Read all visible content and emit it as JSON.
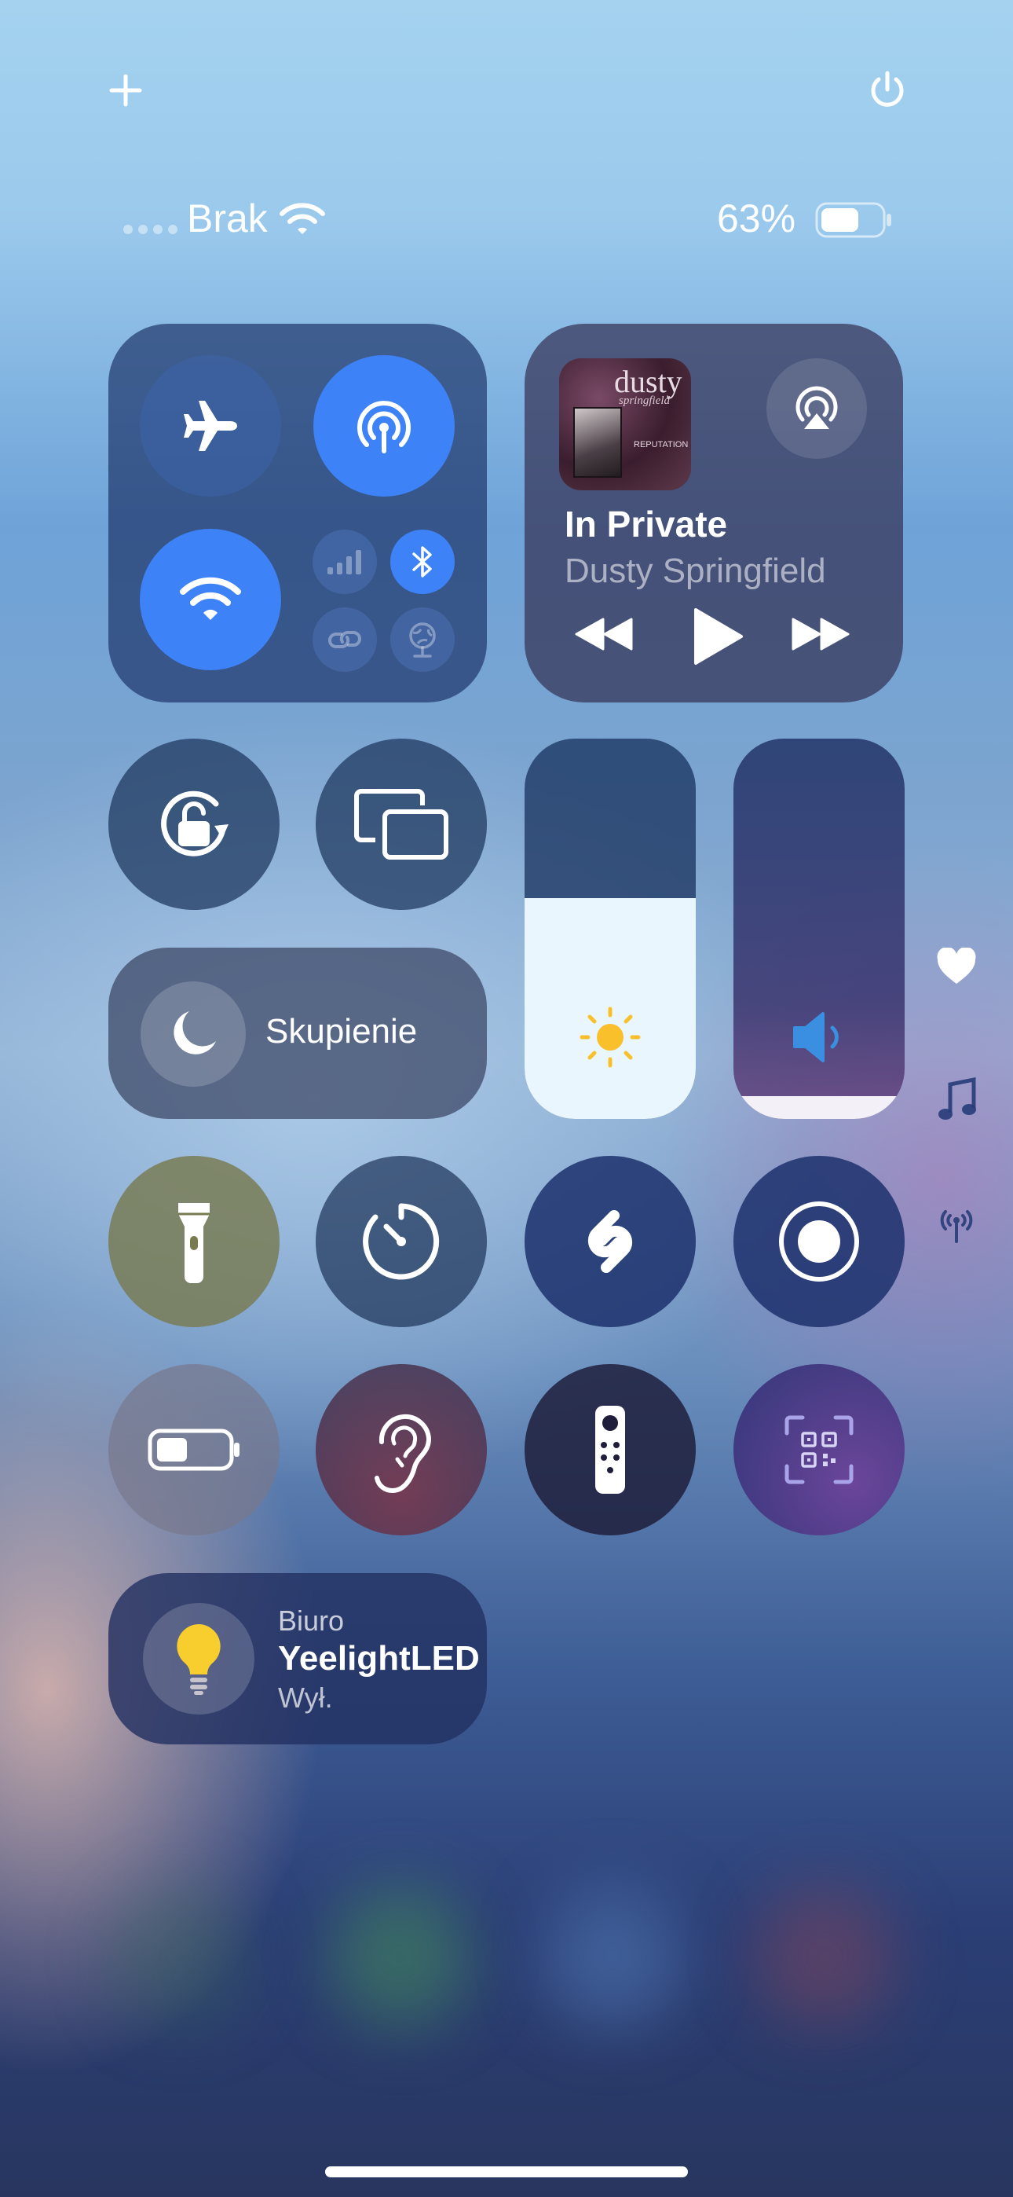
{
  "top": {
    "add_label": "+",
    "power_icon": "power-icon"
  },
  "status": {
    "carrier": "Brak",
    "battery_percent": "63%",
    "battery_level": 0.63
  },
  "connectivity": {
    "airplane_icon": "airplane-icon",
    "airdrop_icon": "airdrop-icon",
    "wifi_icon": "wifi-icon",
    "cellular_icon": "cellular-icon",
    "bluetooth_icon": "bluetooth-icon",
    "personal_hotspot_icon": "link-icon",
    "satellite_icon": "satellite-icon"
  },
  "now_playing": {
    "album_text": "dusty",
    "album_subtext": "springfield",
    "album_small_text": "REPUTATION",
    "title": "In Private",
    "artist": "Dusty Springfield"
  },
  "focus": {
    "label": "Skupienie"
  },
  "sliders": {
    "brightness_level": 0.58,
    "volume_level": 0.06
  },
  "side_icons": [
    "heart-icon",
    "music-note-icon",
    "antenna-icon"
  ],
  "home": {
    "room": "Biuro",
    "device": "YeelightLED",
    "state": "Wył."
  },
  "colors": {
    "accent_blue": "#3d82f6",
    "bulb_yellow": "#f7ce2e",
    "sun_yellow": "#f9c02c",
    "volume_blue": "#3a8fe0"
  }
}
